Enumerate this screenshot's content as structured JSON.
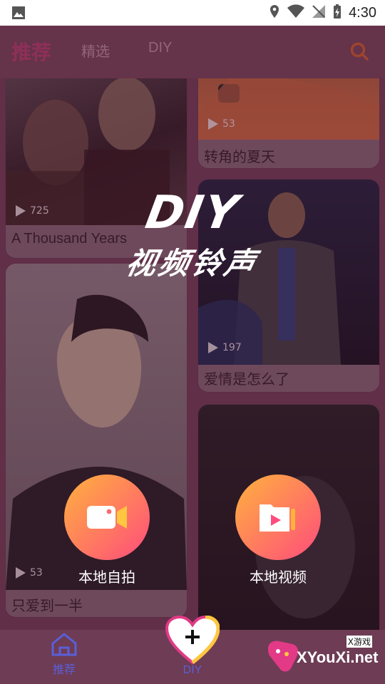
{
  "status_bar": {
    "time": "4:30"
  },
  "nav": {
    "tabs": [
      "推荐",
      "精选",
      "DIY"
    ]
  },
  "cards": [
    {
      "title": "A Thousand Years",
      "plays": "725"
    },
    {
      "title": "转角的夏天",
      "plays": "53"
    },
    {
      "title": "爱情是怎么了",
      "plays": "197"
    },
    {
      "title": "只爱到一半",
      "plays": "53"
    }
  ],
  "overlay": {
    "heading": "DIY",
    "subheading": "视频铃声",
    "actions": [
      {
        "label": "本地自拍"
      },
      {
        "label": "本地视频"
      }
    ]
  },
  "bottom_nav": {
    "home_label": "推荐",
    "diy_label": "DIY"
  },
  "watermark": {
    "site": "XYouXi.net",
    "tag": "X游戏"
  },
  "colors": {
    "accent": "#b03a6a",
    "gradient_start": "#ffb23e",
    "gradient_end": "#ff4c7c",
    "nav_blue": "#5a5fd8"
  }
}
